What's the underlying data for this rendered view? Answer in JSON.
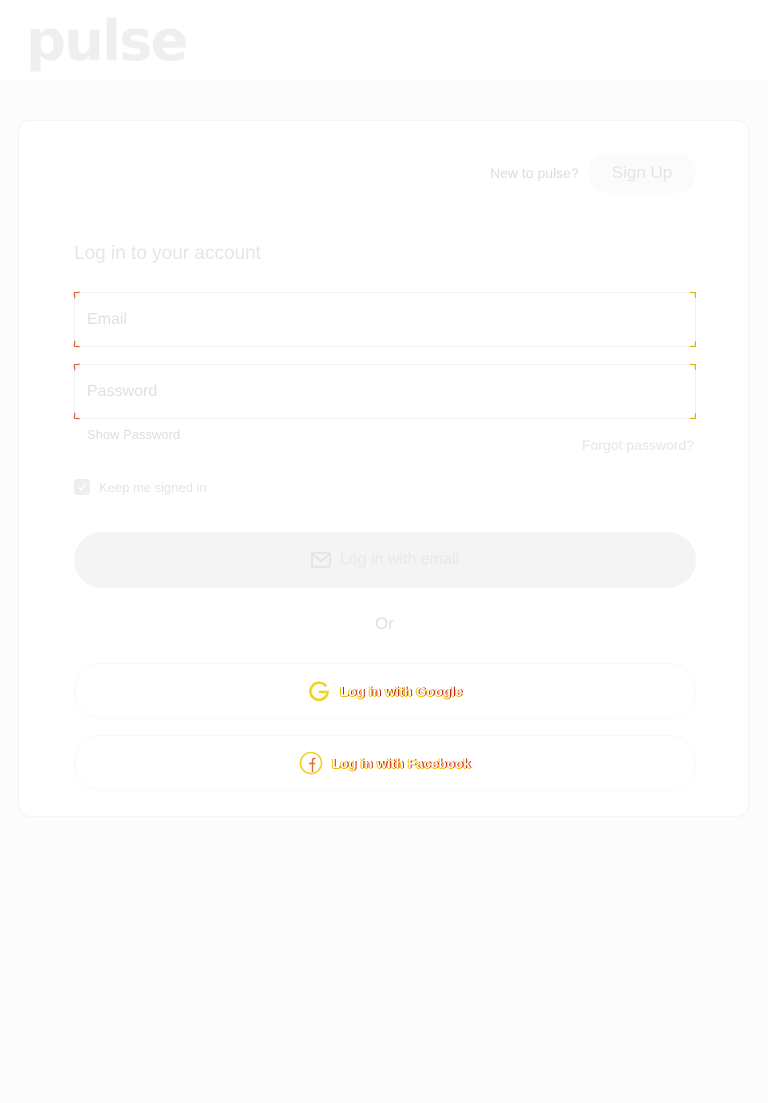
{
  "brand": {
    "logo_text": "pulse"
  },
  "header": {
    "new_to_text": "New to pulse?",
    "signup_label": "Sign Up"
  },
  "form": {
    "heading": "Log in to your account",
    "email_placeholder": "Email",
    "password_placeholder": "Password",
    "show_password_label": "Show Password",
    "forgot_password_label": "Forgot password?",
    "keep_signed_in_label": "Keep me signed in",
    "keep_signed_in_checked": true,
    "email_login_label": "Log in with email",
    "email_login_icon": "envelope-icon",
    "divider_text": "Or",
    "google_login_label": "Log in with Google",
    "google_login_icon": "google-icon",
    "facebook_login_label": "Log in with Facebook",
    "facebook_login_icon": "facebook-icon"
  },
  "colors": {
    "background": "#fcfcfc",
    "card": "#ffffff",
    "primary_button": "#f4f4f4"
  }
}
